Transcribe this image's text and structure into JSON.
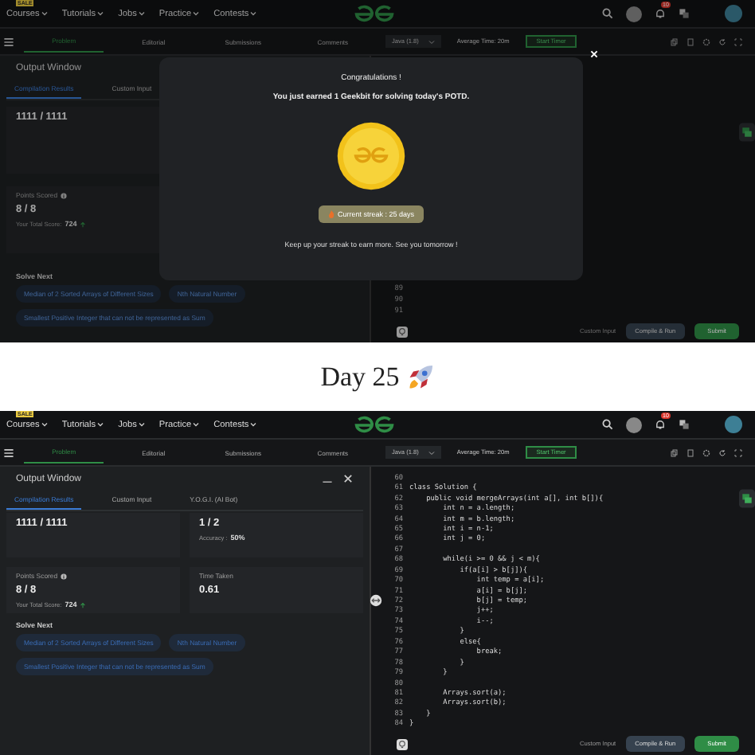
{
  "screenshots": [
    {
      "kind": "modal",
      "nav": {
        "sale_badge": "SALE",
        "menus": [
          "Courses",
          "Tutorials",
          "Jobs",
          "Practice",
          "Contests"
        ],
        "notification_count": "10"
      },
      "tabs": [
        {
          "label": "Problem",
          "selected": true
        },
        {
          "label": "Editorial",
          "selected": false
        },
        {
          "label": "Submissions",
          "selected": false
        },
        {
          "label": "Comments",
          "selected": false
        }
      ],
      "editor": {
        "language": "Java (1.8)",
        "average_time": "Average Time: 20m",
        "timer_button": "Start Timer",
        "lines": [
          {
            "n": "89"
          },
          {
            "n": "90"
          },
          {
            "n": "91"
          }
        ],
        "custom_input": "Custom Input",
        "compile_button": "Compile & Run",
        "submit_button": "Submit"
      },
      "output": {
        "title": "Output Window",
        "tabs": [
          {
            "label": "Compilation Results",
            "selected": true
          },
          {
            "label": "Custom Input",
            "selected": false
          }
        ],
        "cards": [
          {
            "value": "1111 / 1111"
          },
          {
            "label": "Points Scored",
            "info_icon": true,
            "value": "8 / 8",
            "note_label": "Your Total Score:",
            "note_value": "724",
            "trend_icon": true
          }
        ],
        "solve_next": "Solve Next",
        "links": [
          "Median of 2 Sorted Arrays of Different Sizes",
          "Nth Natural Number",
          "Smallest Positive Integer that can not be represented as Sum"
        ]
      },
      "modal": {
        "title": "Congratulations !",
        "message": "You just earned 1 Geekbit for solving today's POTD.",
        "streak": "Current streak : 25 days",
        "footer": "Keep up your streak to earn more. See you tomorrow !"
      }
    },
    {
      "kind": "plain",
      "nav": {
        "sale_badge": "SALE",
        "menus": [
          "Courses",
          "Tutorials",
          "Jobs",
          "Practice",
          "Contests"
        ],
        "notification_count": "10"
      },
      "tabs": [
        {
          "label": "Problem",
          "selected": true
        },
        {
          "label": "Editorial",
          "selected": false
        },
        {
          "label": "Submissions",
          "selected": false
        },
        {
          "label": "Comments",
          "selected": false
        }
      ],
      "editor": {
        "language": "Java (1.8)",
        "average_time": "Average Time: 20m",
        "timer_button": "Start Timer",
        "lines": [
          {
            "n": "60"
          },
          {
            "n": "61",
            "code": "class Solution {"
          },
          {
            "n": "62",
            "code": "    public void mergeArrays(int a[], int b[]){"
          },
          {
            "n": "63",
            "code": "        int n = a.length;"
          },
          {
            "n": "64",
            "code": "        int m = b.length;"
          },
          {
            "n": "65",
            "code": "        int i = n-1;"
          },
          {
            "n": "66",
            "code": "        int j = 0;"
          },
          {
            "n": "67"
          },
          {
            "n": "68",
            "code": "        while(i >= 0 && j < m){"
          },
          {
            "n": "69",
            "code": "            if(a[i] > b[j]){"
          },
          {
            "n": "70",
            "code": "                int temp = a[i];"
          },
          {
            "n": "71",
            "code": "                a[i] = b[j];"
          },
          {
            "n": "72",
            "code": "                b[j] = temp;"
          },
          {
            "n": "73",
            "code": "                j++;"
          },
          {
            "n": "74",
            "code": "                i--;"
          },
          {
            "n": "75",
            "code": "            }"
          },
          {
            "n": "76",
            "code": "            else{"
          },
          {
            "n": "77",
            "code": "                break;"
          },
          {
            "n": "78",
            "code": "            }"
          },
          {
            "n": "79",
            "code": "        }"
          },
          {
            "n": "80"
          },
          {
            "n": "81",
            "code": "        Arrays.sort(a);"
          },
          {
            "n": "82",
            "code": "        Arrays.sort(b);"
          },
          {
            "n": "83",
            "code": "    }"
          },
          {
            "n": "84",
            "code": "}"
          }
        ],
        "custom_input": "Custom Input",
        "compile_button": "Compile & Run",
        "submit_button": "Submit"
      },
      "output": {
        "title": "Output Window",
        "window_controls": true,
        "tabs": [
          {
            "label": "Compilation Results",
            "selected": true
          },
          {
            "label": "Custom Input",
            "selected": false
          },
          {
            "label": "Y.O.G.I. (AI Bot)",
            "selected": false
          }
        ],
        "cards": [
          {
            "value": "1111 / 1111"
          },
          {
            "value": "1 / 2",
            "note_label": "Accuracy :",
            "note_value": "50%"
          },
          {
            "label": "Points Scored",
            "info_icon": true,
            "value": "8 / 8",
            "note_label": "Your Total Score:",
            "note_value": "724",
            "trend_icon": true
          },
          {
            "label": "Time Taken",
            "value": "0.61"
          }
        ],
        "solve_next": "Solve Next",
        "links": [
          "Median of 2 Sorted Arrays of Different Sizes",
          "Nth Natural Number",
          "Smallest Positive Integer that can not be represented as Sum"
        ]
      }
    }
  ],
  "caption": {
    "text": "Day 25"
  }
}
